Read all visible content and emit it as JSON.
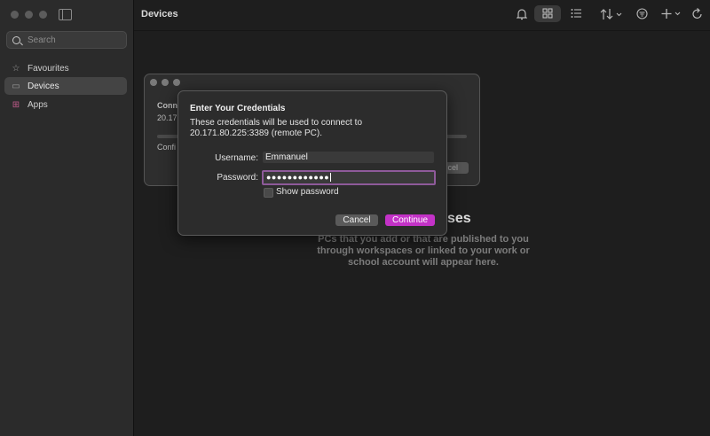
{
  "sidebar": {
    "search_placeholder": "Search",
    "items": [
      {
        "label": "Favourites",
        "icon": "star-icon"
      },
      {
        "label": "Devices",
        "icon": "monitor-icon"
      },
      {
        "label": "Apps",
        "icon": "apps-grid-icon"
      }
    ],
    "selected": "Devices"
  },
  "header": {
    "title": "Devices",
    "toolbar_icons": [
      "bell-icon",
      "grid-view-icon",
      "list-view-icon",
      "sort-icon",
      "filter-icon",
      "add-icon",
      "refresh-icon"
    ]
  },
  "empty_state": {
    "title_visible": "ses",
    "text": "PCs that you add or that are published to you through workspaces or linked to your work or school account will appear here."
  },
  "connecting_window": {
    "line1": "Conn",
    "line2": "20.171",
    "line3": "Confi",
    "cancel_label": "cel"
  },
  "dialog": {
    "title": "Enter Your Credentials",
    "message": "These credentials will be used to connect to 20.171.80.225:3389 (remote PC).",
    "username_label": "Username:",
    "username_value": "Emmanuel",
    "password_label": "Password:",
    "password_mask": "●●●●●●●●●●●●",
    "show_password_label": "Show password",
    "show_password_checked": false,
    "cancel_label": "Cancel",
    "continue_label": "Continue"
  },
  "colors": {
    "accent": "#c332c7",
    "focus_ring": "#8e5a9a",
    "sidebar_bg": "#2b2b2b",
    "main_bg": "#1e1e1e"
  }
}
